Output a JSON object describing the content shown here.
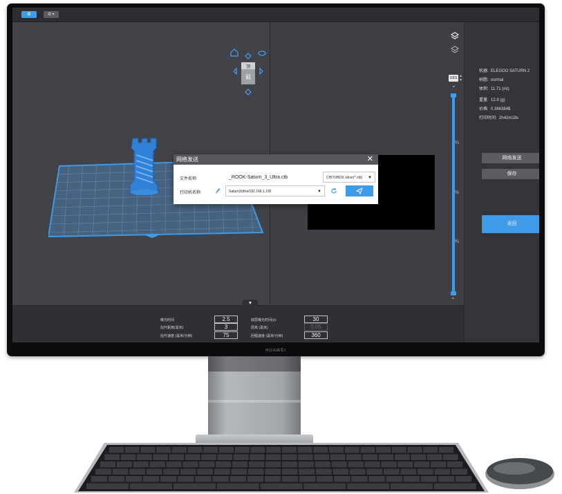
{
  "topbar": {
    "btn1_label": "⧉",
    "btn2_label": "⧉ ▾"
  },
  "navcube": {
    "top_label": "顶",
    "front_label": "前"
  },
  "layer": {
    "current": "1001",
    "ticks": [
      "¼",
      "½",
      "¾"
    ]
  },
  "info": {
    "machine_label": "机器:",
    "machine_value": "ELEGOO SATURN 2",
    "resin_label": "树脂:",
    "resin_value": "normal",
    "volume_label": "体积:",
    "volume_value": "11.71 (ml)",
    "weight_label": "重量:",
    "weight_value": "12.9 (g)",
    "price_label": "价格:",
    "price_value": "0.386384$",
    "time_label": "打印时间:",
    "time_value": "2h42m18s"
  },
  "panel": {
    "network_send": "网络发送",
    "save": "保存",
    "back": "返回"
  },
  "params": {
    "exposure_label": "曝光时间",
    "exposure_value": "2.5",
    "lift_dist_label": "抬升距离(毫米)",
    "lift_dist_value": "3",
    "lift_speed_label": "抬升速度 (毫米/分钟)",
    "lift_speed_value": "75",
    "bottom_exposure_label": "底层曝光时间(s):",
    "bottom_exposure_value": "30",
    "layer_height_label": "层高 (毫米)",
    "layer_height_value": "0.05",
    "retract_speed_label": "回程速度 (毫米/分钟)",
    "retract_speed_value": "360"
  },
  "dialog": {
    "title": "网络发送",
    "file_label": "文件名称:",
    "file_value": "_ROOK-Saturn_3_Ultra.ctb",
    "format_value": "CHITUBOX slicer(*.ctb)",
    "printer_label": "打印机名称:",
    "printer_value": "Saturn3Ultra/192.168.1.195"
  },
  "monitor_brand": "HUAWEI",
  "colors": {
    "accent": "#3d9be9",
    "model": "#2f80d6"
  }
}
